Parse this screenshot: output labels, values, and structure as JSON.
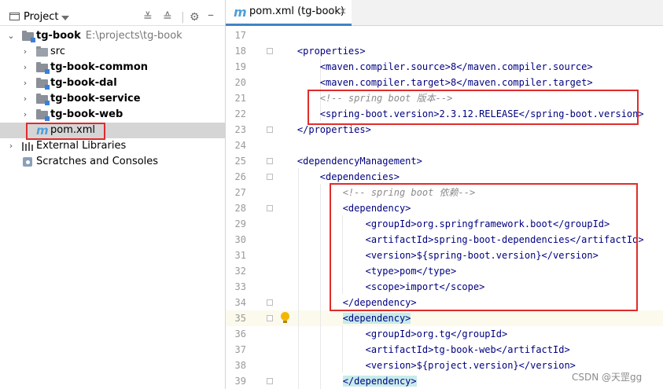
{
  "project_panel": {
    "title": "Project",
    "tree": {
      "root": {
        "name": "tg-book",
        "path": "E:\\projects\\tg-book"
      },
      "items": [
        {
          "name": "src"
        },
        {
          "name": "tg-book-common"
        },
        {
          "name": "tg-book-dal"
        },
        {
          "name": "tg-book-service"
        },
        {
          "name": "tg-book-web"
        },
        {
          "name": "pom.xml"
        },
        {
          "name": "External Libraries"
        },
        {
          "name": "Scratches and Consoles"
        }
      ]
    }
  },
  "editor": {
    "tab": {
      "label": "pom.xml (tg-book)",
      "close": "×"
    },
    "lines": [
      {
        "n": "17",
        "code": ""
      },
      {
        "n": "18",
        "code": "    <properties>"
      },
      {
        "n": "19",
        "code": "        <maven.compiler.source>8</maven.compiler.source>"
      },
      {
        "n": "20",
        "code": "        <maven.compiler.target>8</maven.compiler.target>"
      },
      {
        "n": "21",
        "code": "        <!-- spring boot 版本-->"
      },
      {
        "n": "22",
        "code": "        <spring-boot.version>2.3.12.RELEASE</spring-boot.version>"
      },
      {
        "n": "23",
        "code": "    </properties>"
      },
      {
        "n": "24",
        "code": ""
      },
      {
        "n": "25",
        "code": "    <dependencyManagement>"
      },
      {
        "n": "26",
        "code": "        <dependencies>"
      },
      {
        "n": "27",
        "code": "            <!-- spring boot 依赖-->"
      },
      {
        "n": "28",
        "code": "            <dependency>"
      },
      {
        "n": "29",
        "code": "                <groupId>org.springframework.boot</groupId>"
      },
      {
        "n": "30",
        "code": "                <artifactId>spring-boot-dependencies</artifactId>"
      },
      {
        "n": "31",
        "code": "                <version>${spring-boot.version}</version>"
      },
      {
        "n": "32",
        "code": "                <type>pom</type>"
      },
      {
        "n": "33",
        "code": "                <scope>import</scope>"
      },
      {
        "n": "34",
        "code": "            </dependency>"
      },
      {
        "n": "35",
        "code": "            <dependency>"
      },
      {
        "n": "36",
        "code": "                <groupId>org.tg</groupId>"
      },
      {
        "n": "37",
        "code": "                <artifactId>tg-book-web</artifactId>"
      },
      {
        "n": "38",
        "code": "                <version>${project.version}</version>"
      },
      {
        "n": "39",
        "code": "            </dependency>"
      }
    ]
  },
  "watermark": "CSDN @天罡gg",
  "colors": {
    "tag": "#000080",
    "comment": "#8c8c8c",
    "highlight": "#c7ebeb",
    "redbox": "#e12b2b",
    "accent": "#4083c9"
  }
}
